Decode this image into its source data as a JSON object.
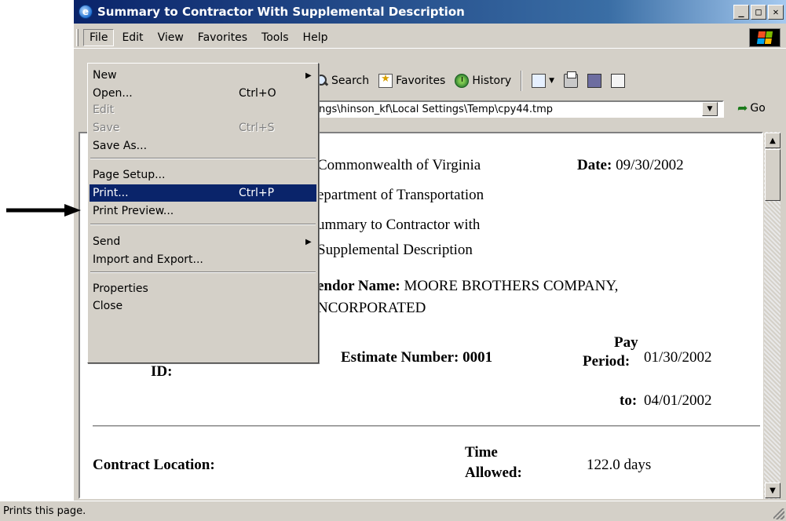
{
  "window": {
    "title": "Summary to Contractor With Supplemental Description",
    "minimize": "_",
    "maximize": "□",
    "close": "✕"
  },
  "menubar": {
    "file": "File",
    "edit": "Edit",
    "view": "View",
    "favorites": "Favorites",
    "tools": "Tools",
    "help": "Help"
  },
  "toolbar": {
    "search": "Search",
    "favorites": "Favorites",
    "history": "History"
  },
  "address": {
    "value": "ngs\\hinson_kf\\Local Settings\\Temp\\cpy44.tmp",
    "go": "Go"
  },
  "file_menu": {
    "new": "New",
    "open": "Open...",
    "open_shortcut": "Ctrl+O",
    "edit": "Edit",
    "save": "Save",
    "save_shortcut": "Ctrl+S",
    "save_as": "Save As...",
    "page_setup": "Page Setup...",
    "print": "Print...",
    "print_shortcut": "Ctrl+P",
    "print_preview": "Print Preview...",
    "send": "Send",
    "import_export": "Import and Export...",
    "properties": "Properties",
    "close": "Close"
  },
  "document": {
    "org_line1": "Commonwealth of Virginia",
    "org_line2": "epartment of Transportation",
    "report_line1": "ummary to Contractor with",
    "report_line2": "Supplemental Description",
    "date_label": "Date:",
    "date_value": "09/30/2002",
    "vendor_label": "endor Name:",
    "vendor_value": "MOORE BROTHERS COMPANY,",
    "vendor_value2": "NCORPORATED",
    "id_label": "ID:",
    "estimate_label": "Estimate Number:",
    "estimate_value": "0001",
    "pay_label1": "Pay",
    "pay_label2": "Period:",
    "pay_from": "01/30/2002",
    "to_label": "to:",
    "pay_to": "04/01/2002",
    "location_label": "Contract Location:",
    "time_label1": "Time",
    "time_label2": "Allowed:",
    "time_value": "122.0 days"
  },
  "status": {
    "text": "Prints this page."
  }
}
